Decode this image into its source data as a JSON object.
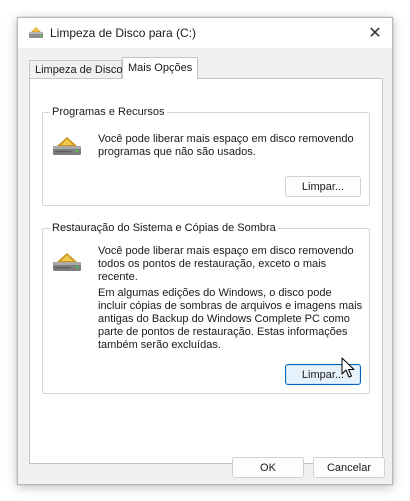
{
  "window": {
    "title": "Limpeza de Disco para  (C:)",
    "icon": "disk-cleanup-icon",
    "close_icon": "close-icon"
  },
  "tabs": [
    {
      "label": "Limpeza de Disco",
      "active": false
    },
    {
      "label": "Mais Opções",
      "active": true
    }
  ],
  "groups": {
    "programs": {
      "title": "Programas e Recursos",
      "description": "Você pode liberar mais espaço em disco removendo programas que não são usados.",
      "button_label": "Limpar..."
    },
    "restore": {
      "title": "Restauração do Sistema e Cópias de Sombra",
      "description": "Você pode liberar mais espaço em disco removendo todos os pontos de restauração, exceto o mais recente.",
      "note": "Em algumas edições do Windows, o disco pode incluir cópias de sombras de arquivos e imagens mais antigas do Backup do Windows Complete PC como parte de pontos de restauração. Estas informações também serão excluídas.",
      "button_label": "Limpar..."
    }
  },
  "footer": {
    "ok_label": "OK",
    "cancel_label": "Cancelar"
  },
  "colors": {
    "accent": "#0067c0",
    "focused_button_bg": "#e5f1fb",
    "dialog_bg": "#f0f0f0"
  }
}
